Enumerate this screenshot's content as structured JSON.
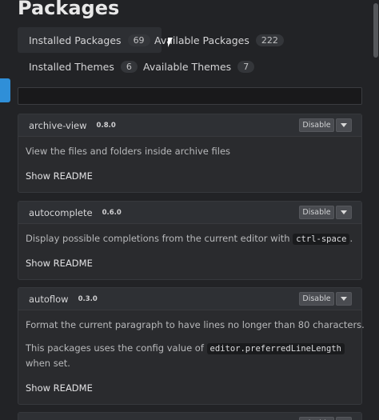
{
  "header": {
    "title": "Packages"
  },
  "tabs": [
    {
      "label": "Installed Packages",
      "count": "69"
    },
    {
      "label": "Available Packages",
      "count": "222"
    },
    {
      "label": "Installed Themes",
      "count": "6"
    },
    {
      "label": "Available Themes",
      "count": "7"
    }
  ],
  "search": {
    "value": "",
    "placeholder": ""
  },
  "packages": [
    {
      "name": "archive-view",
      "version": "0.8.0",
      "disable_label": "Disable",
      "description": "View the files and folders inside archive files",
      "readme_label": "Show README"
    },
    {
      "name": "autocomplete",
      "version": "0.6.0",
      "disable_label": "Disable",
      "description_before": "Display possible completions from the current editor with",
      "description_code": "ctrl-space",
      "description_after": ".",
      "readme_label": "Show README"
    },
    {
      "name": "autoflow",
      "version": "0.3.0",
      "disable_label": "Disable",
      "description": "Format the current paragraph to have lines no longer than 80 characters.",
      "description2_before": "This packages uses the config value of",
      "description2_code": "editor.preferredLineLength",
      "description2_after": "when set.",
      "readme_label": "Show README"
    }
  ],
  "colors": {
    "background": "#222326",
    "card": "#2a2b2e",
    "accent": "#2f8fd8"
  },
  "icons": {
    "dropdown": "caret-down-icon",
    "pointer": "mouse-cursor-icon"
  }
}
